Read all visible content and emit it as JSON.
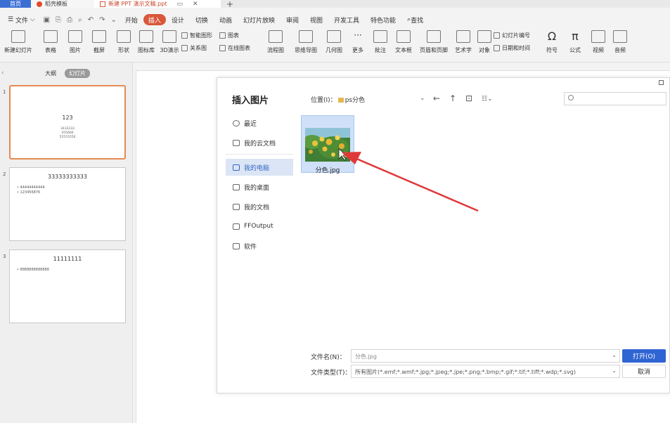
{
  "tabs": {
    "home": "首页",
    "template": "稻壳模板",
    "document": "新建 PPT 演示文稿.ppt",
    "new_tab": "+"
  },
  "menu": {
    "file": "文件",
    "items": [
      "开始",
      "插入",
      "设计",
      "切换",
      "动画",
      "幻灯片放映",
      "审阅",
      "视图",
      "开发工具",
      "特色功能"
    ],
    "active": "插入",
    "search": "查找"
  },
  "ribbon": {
    "new_slide": "新建幻灯片",
    "table": "表格",
    "picture": "图片",
    "screenshot": "截屏",
    "shape": "形状",
    "icon_lib": "图标库",
    "demo_3d": "3D演示",
    "smart_shape": "智能图形",
    "relation": "关系图",
    "chart": "图表",
    "online_chart": "在线图表",
    "flowchart": "流程图",
    "mindmap": "思维导图",
    "geometry": "几何图",
    "more": "更多",
    "comment": "批注",
    "textbox": "文本框",
    "header_footer": "页眉和页脚",
    "wordart": "艺术字",
    "object": "对象",
    "slide_number": "幻灯片编号",
    "date_time": "日期和时间",
    "symbol": "符号",
    "formula": "公式",
    "video": "视频",
    "audio": "音频"
  },
  "left_panel": {
    "outline_tab": "大纲",
    "slides_tab": "幻灯片",
    "slides": [
      {
        "num": "1",
        "title": "123",
        "lines": [
          "3433333",
          "455666",
          "55555556"
        ]
      },
      {
        "num": "2",
        "title": "33333333333",
        "bullets": [
          "• 44444444444",
          "• 123456876"
        ]
      },
      {
        "num": "3",
        "title": "11111111",
        "bullets": [
          "• 8888888888888"
        ]
      }
    ]
  },
  "dialog": {
    "title": "插入图片",
    "location_label": "位置(I)：",
    "location_value": "ps分色",
    "search_placeholder": "",
    "nav": [
      "最近",
      "我的云文档",
      "我的电脑",
      "我的桌面",
      "我的文档",
      "FFOutput",
      "软件"
    ],
    "active_nav": "我的电脑",
    "file_name": "分色.jpg",
    "filename_label": "文件名(N)：",
    "filename_value": "分色.jpg",
    "filetype_label": "文件类型(T)：",
    "filetype_value": "所有图片(*.emf;*.wmf;*.jpg;*.jpeg;*.jpe;*.png;*.bmp;*.gif;*.tif;*.tiff;*.wdp;*.svg)",
    "open_button": "打开(O)",
    "cancel_button": "取消"
  },
  "colors": {
    "accent": "#d9573a",
    "primary_button": "#2f64d3",
    "selection": "#cfe0f8",
    "annotation_arrow": "#e0383a"
  }
}
